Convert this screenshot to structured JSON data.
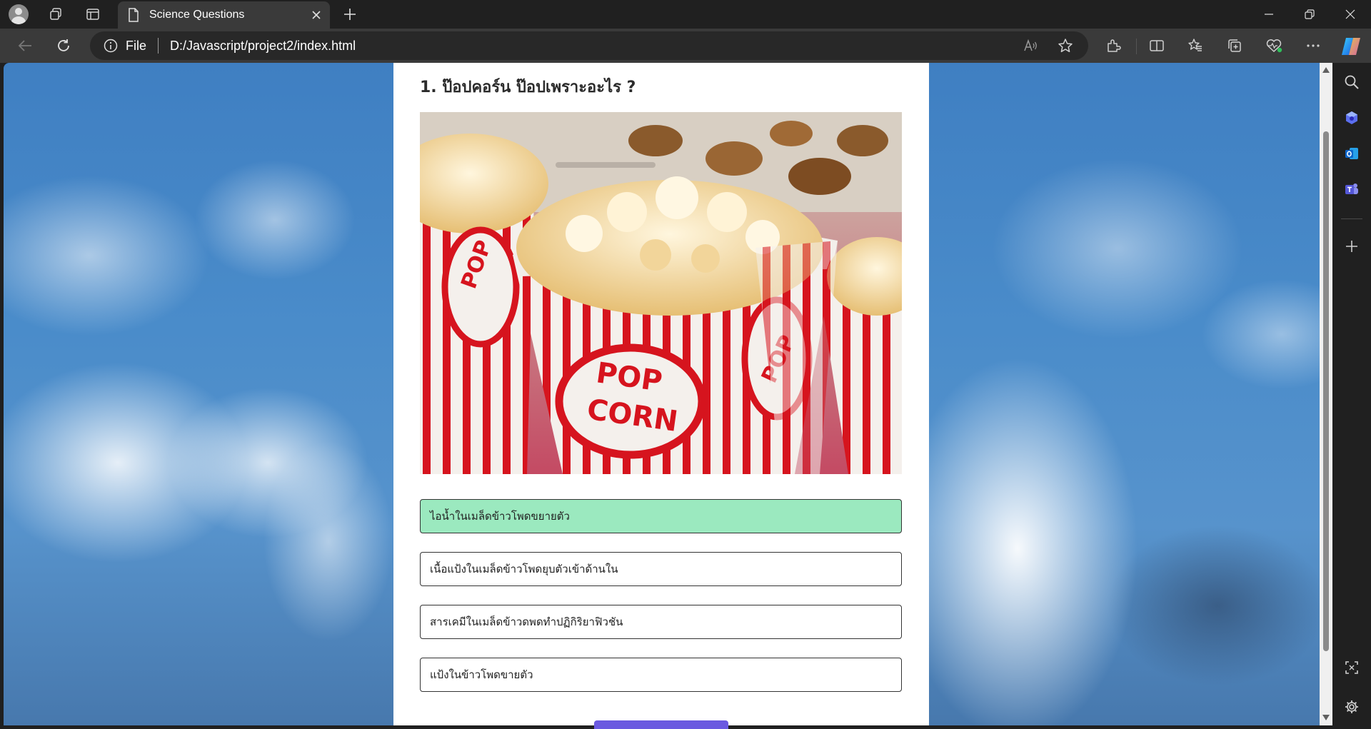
{
  "browser": {
    "tab": {
      "title": "Science Questions"
    },
    "address": {
      "scheme": "File",
      "url": "D:/Javascript/project2/index.html"
    }
  },
  "quiz": {
    "question": "1. ป๊อปคอร์น ป๊อปเพราะอะไร ?",
    "image_alt": "popcorn boxes",
    "answers": [
      {
        "text": "ไอน้ำในเมล็ดข้าวโพดขยายตัว",
        "state": "correct"
      },
      {
        "text": "เนื้อแป้งในเมล็ดข้าวโพดยุบตัวเข้าด้านใน",
        "state": "neutral"
      },
      {
        "text": "สารเคมีในเมล็ดข้าวดพดทำปฏิกิริยาฟิวชัน",
        "state": "neutral"
      },
      {
        "text": "แป้งในข้าวโพดขายตัว",
        "state": "neutral"
      }
    ]
  },
  "colors": {
    "correct_answer": "#9be9bf",
    "next_button": "#6b5ae0",
    "popcorn_red": "#d6141e"
  },
  "icons": {
    "tabstrip": [
      "profile-icon",
      "workspaces-icon",
      "tab-actions-icon",
      "page-icon",
      "close-icon",
      "plus-icon"
    ],
    "toolbar": [
      "back-icon",
      "refresh-icon",
      "info-icon",
      "read-aloud-icon",
      "star-icon",
      "extensions-icon",
      "split-screen-icon",
      "favorites-icon",
      "collections-icon",
      "browser-essentials-icon",
      "more-icon",
      "copilot-icon"
    ],
    "sidebar": [
      "search-icon",
      "copilot-icon",
      "outlook-icon",
      "teams-icon",
      "plus-icon",
      "screenshot-icon",
      "settings-icon"
    ]
  }
}
